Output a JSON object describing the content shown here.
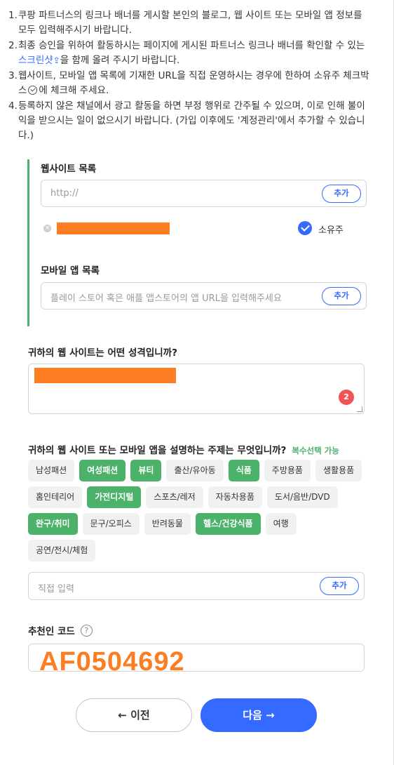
{
  "instructions": [
    {
      "num": "1.",
      "text": "쿠팡 파트너스의 링크나 배너를 게시할 본인의 블로그, 웹 사이트 또는 모바일 앱 정보를 모두 입력해주시기 바랍니다."
    },
    {
      "num": "2.",
      "pre": "최종 승인을 위하여 활동하시는 페이지에 게시된 파트너스 링크나 배너를 확인할 수 있는",
      "link": "스크린샷",
      "post": "을 함께 올려 주시기 바랍니다."
    },
    {
      "num": "3.",
      "pre": "웹사이트, 모바일 앱 목록에 기재한 URL을 직접 운영하시는 경우에 한하여 소유주 체크박스",
      "post": "에 체크해 주세요."
    },
    {
      "num": "4.",
      "text": "등록하지 않은 채널에서 광고 활동을 하면 부정 행위로 간주될 수 있으며, 이로 인해 불이익을 받으시는 일이 없으시기 바랍니다. (가입 이후에도 '계정관리'에서 추가할 수 있습니다.)"
    }
  ],
  "website": {
    "label": "웹사이트 목록",
    "placeholder": "http://",
    "add_label": "추가",
    "owner_label": "소유주"
  },
  "app": {
    "label": "모바일 앱 목록",
    "placeholder": "플레이 스토어 혹은 애플 앱스토어의 앱 URL을 입력해주세요",
    "add_label": "추가"
  },
  "site_type": {
    "question": "귀하의 웹 사이트는 어떤 성격입니까?",
    "badge": "2"
  },
  "topics": {
    "question": "귀하의 웹 사이트 또는 모바일 앱을 설명하는 주제는 무엇입니까?",
    "note": "복수선택 가능",
    "tags": [
      {
        "label": "남성패션",
        "selected": false
      },
      {
        "label": "여성패션",
        "selected": true
      },
      {
        "label": "뷰티",
        "selected": true
      },
      {
        "label": "출산/유아동",
        "selected": false
      },
      {
        "label": "식품",
        "selected": true
      },
      {
        "label": "주방용품",
        "selected": false
      },
      {
        "label": "생활용품",
        "selected": false
      },
      {
        "label": "홈인테리어",
        "selected": false
      },
      {
        "label": "가전디지털",
        "selected": true
      },
      {
        "label": "스포츠/레저",
        "selected": false
      },
      {
        "label": "자동차용품",
        "selected": false
      },
      {
        "label": "도서/음반/DVD",
        "selected": false
      },
      {
        "label": "완구/취미",
        "selected": true
      },
      {
        "label": "문구/오피스",
        "selected": false
      },
      {
        "label": "반려동물",
        "selected": false
      },
      {
        "label": "헬스/건강식품",
        "selected": true
      },
      {
        "label": "여행",
        "selected": false
      },
      {
        "label": "공연/전시/체험",
        "selected": false
      }
    ],
    "direct_placeholder": "직접 입력",
    "add_label": "추가"
  },
  "referral": {
    "label": "추천인 코드",
    "help": "?",
    "code": "AF0504692"
  },
  "nav": {
    "prev_label": "← 이전",
    "next_label": "다음 →"
  },
  "colors": {
    "accent": "#346aff",
    "selected_tag": "#4cb26a",
    "redaction": "#fd7e22",
    "badge": "#f25454"
  }
}
